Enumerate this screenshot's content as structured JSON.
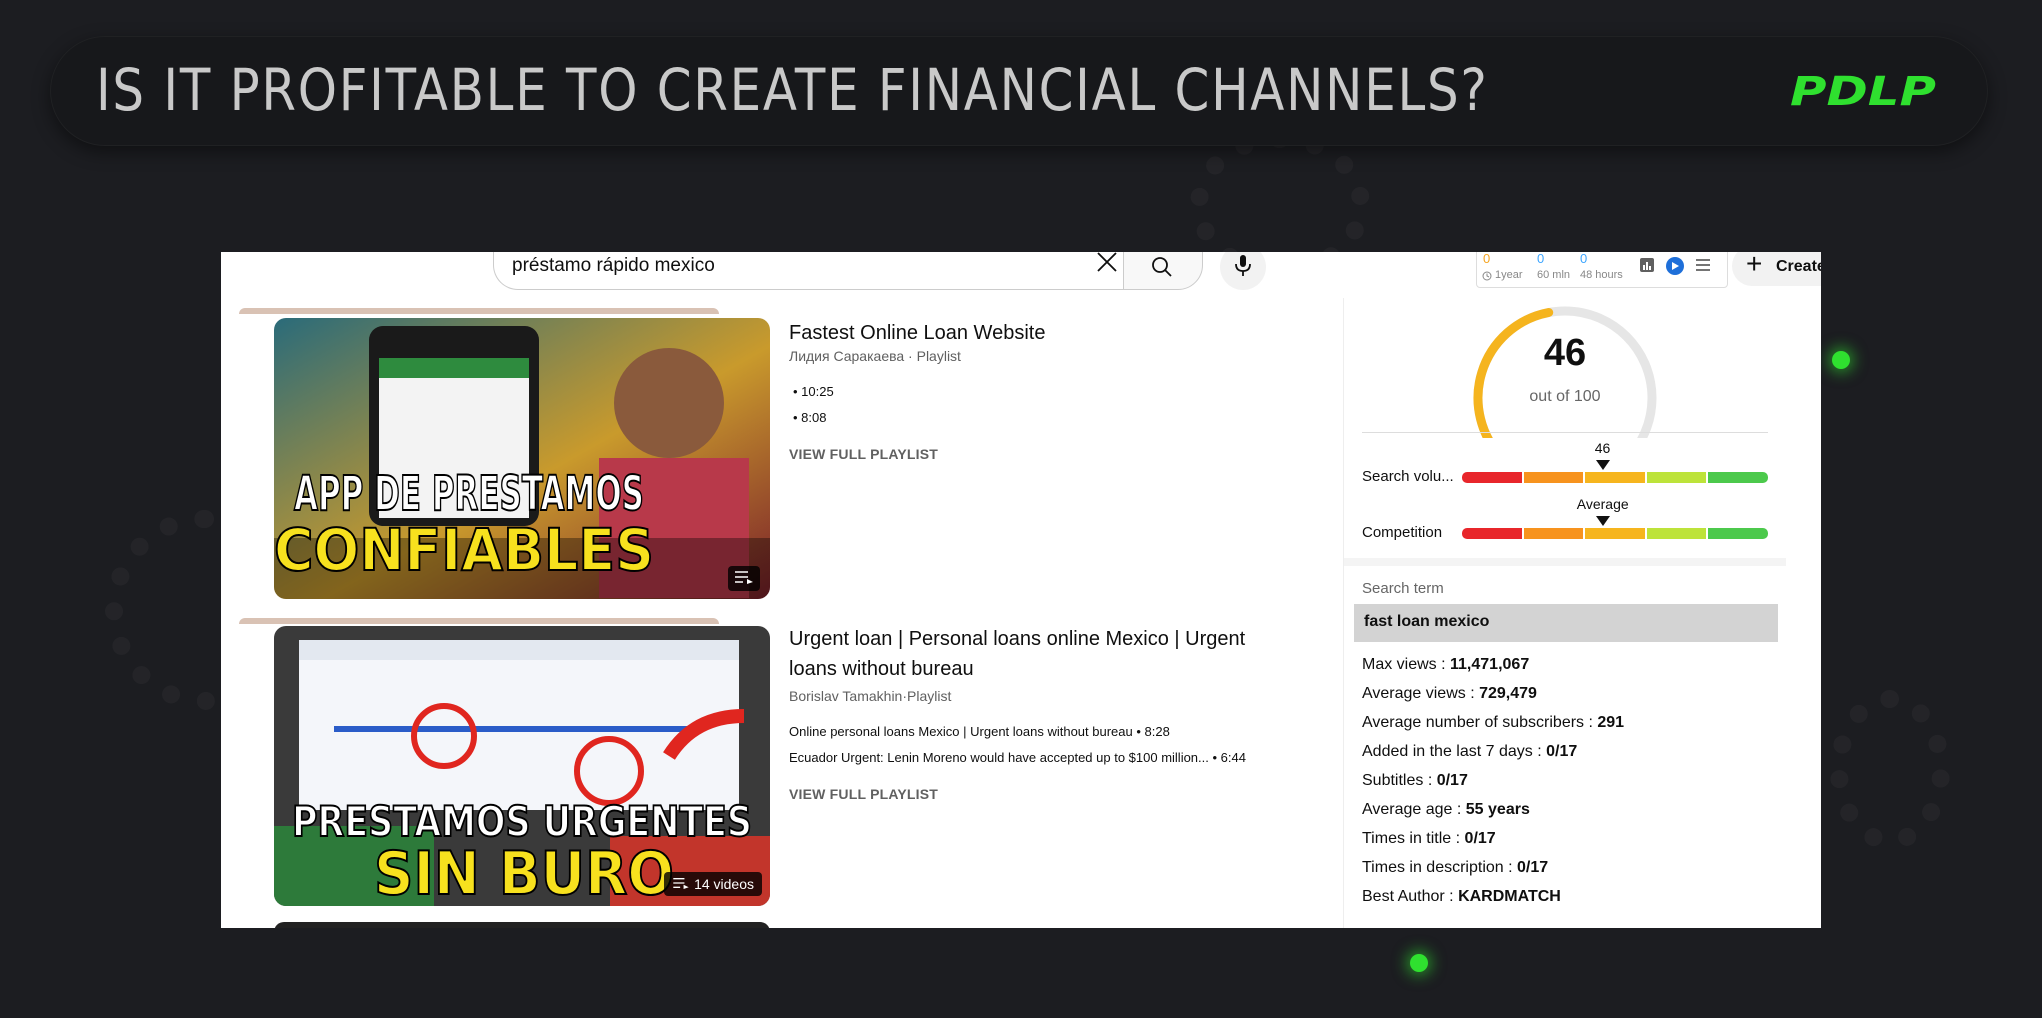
{
  "banner": {
    "title": "IS IT PROFITABLE TO CREATE FINANCIAL CHANNELS?",
    "logo_text": "PDLP",
    "accent": "#2fe02f"
  },
  "search": {
    "query": "préstamo rápido mexico",
    "clear_icon": "close-icon",
    "search_icon": "search-icon",
    "mic_icon": "microphone-icon"
  },
  "extension": {
    "stats": [
      {
        "value": "0",
        "label": "1year",
        "color": "#f5a623"
      },
      {
        "value": "0",
        "label": "60 mln",
        "color": "#3ea6ff"
      },
      {
        "value": "0",
        "label": "48 hours",
        "color": "#3ea6ff"
      }
    ]
  },
  "create": {
    "label": "Create"
  },
  "results": [
    {
      "thumb_text_top": "APP DE PRESTAMOS",
      "thumb_text_bottom": "CONFIABLES",
      "thumb_badge": "",
      "title": "Fastest Online Loan Website",
      "author": "Лидия Саракаева · Playlist",
      "items": [
        "• 10:25",
        "• 8:08"
      ],
      "view_full": "VIEW FULL PLAYLIST"
    },
    {
      "thumb_text_top": "PRESTAMOS URGENTES",
      "thumb_text_bottom": "SIN BURO",
      "thumb_badge": "14 videos",
      "title": "Urgent loan | Personal loans online Mexico | Urgent loans without bureau",
      "author": "Borislav Tamakhin·Playlist",
      "items": [
        "Online personal loans Mexico | Urgent loans without bureau • 8:28",
        "Ecuador Urgent: Lenin Moreno would have accepted up to $100 million... • 6:44"
      ],
      "view_full": "VIEW FULL PLAYLIST"
    }
  ],
  "panel": {
    "score": "46",
    "score_sub": "out of 100",
    "score_fraction": 0.46,
    "search_volume": {
      "label": "Search volu...",
      "value": "46",
      "position": 0.46
    },
    "competition": {
      "label": "Competition",
      "value": "Average",
      "position": 0.46
    },
    "bar_colors": [
      "#e8262b",
      "#f7931e",
      "#f6b51e",
      "#bde33a",
      "#4cc94c"
    ],
    "search_term_label": "Search term",
    "search_term": "fast loan mexico",
    "stats": [
      {
        "label": "Max views : ",
        "value": "11,471,067"
      },
      {
        "label": "Average views : ",
        "value": "729,479"
      },
      {
        "label": "Average number of subscribers : ",
        "value": "291"
      },
      {
        "label": "Added in the last 7 days : ",
        "value": "0/17"
      },
      {
        "label": "Subtitles : ",
        "value": "0/17"
      },
      {
        "label": "Average age : ",
        "value": "55 years"
      },
      {
        "label": "Times in title : ",
        "value": "0/17"
      },
      {
        "label": "Times in description : ",
        "value": "0/17"
      },
      {
        "label": "Best Author : ",
        "value": "KARDMATCH"
      }
    ]
  }
}
